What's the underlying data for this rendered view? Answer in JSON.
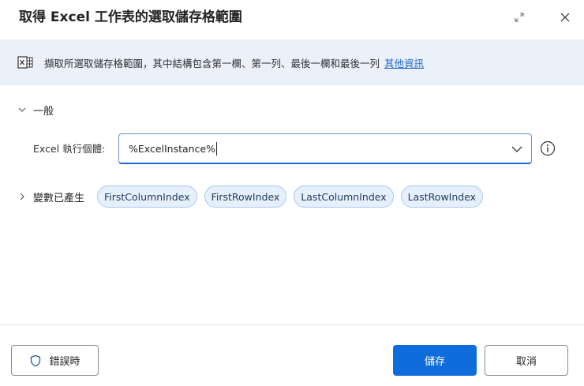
{
  "dialog": {
    "title": "取得 Excel 工作表的選取儲存格範圍",
    "expand_icon": "expand-icon",
    "close_icon": "close-icon"
  },
  "info": {
    "icon": "excel-table-icon",
    "text": "擷取所選取儲存格範圍，其中結構包含第一欄、第一列、最後一欄和最後一列",
    "link": "其他資訊"
  },
  "general": {
    "label": "一般",
    "field_label": "Excel 執行個體:",
    "field_value": "%ExcelInstance%"
  },
  "variables": {
    "label": "變數已產生",
    "items": [
      "FirstColumnIndex",
      "FirstRowIndex",
      "LastColumnIndex",
      "LastRowIndex"
    ]
  },
  "footer": {
    "on_error_label": "錯誤時",
    "save_label": "儲存",
    "cancel_label": "取消"
  },
  "colors": {
    "accent": "#0f6cdb",
    "info_bg": "#eaf1fb",
    "chip_bg": "#e6f0fc"
  }
}
